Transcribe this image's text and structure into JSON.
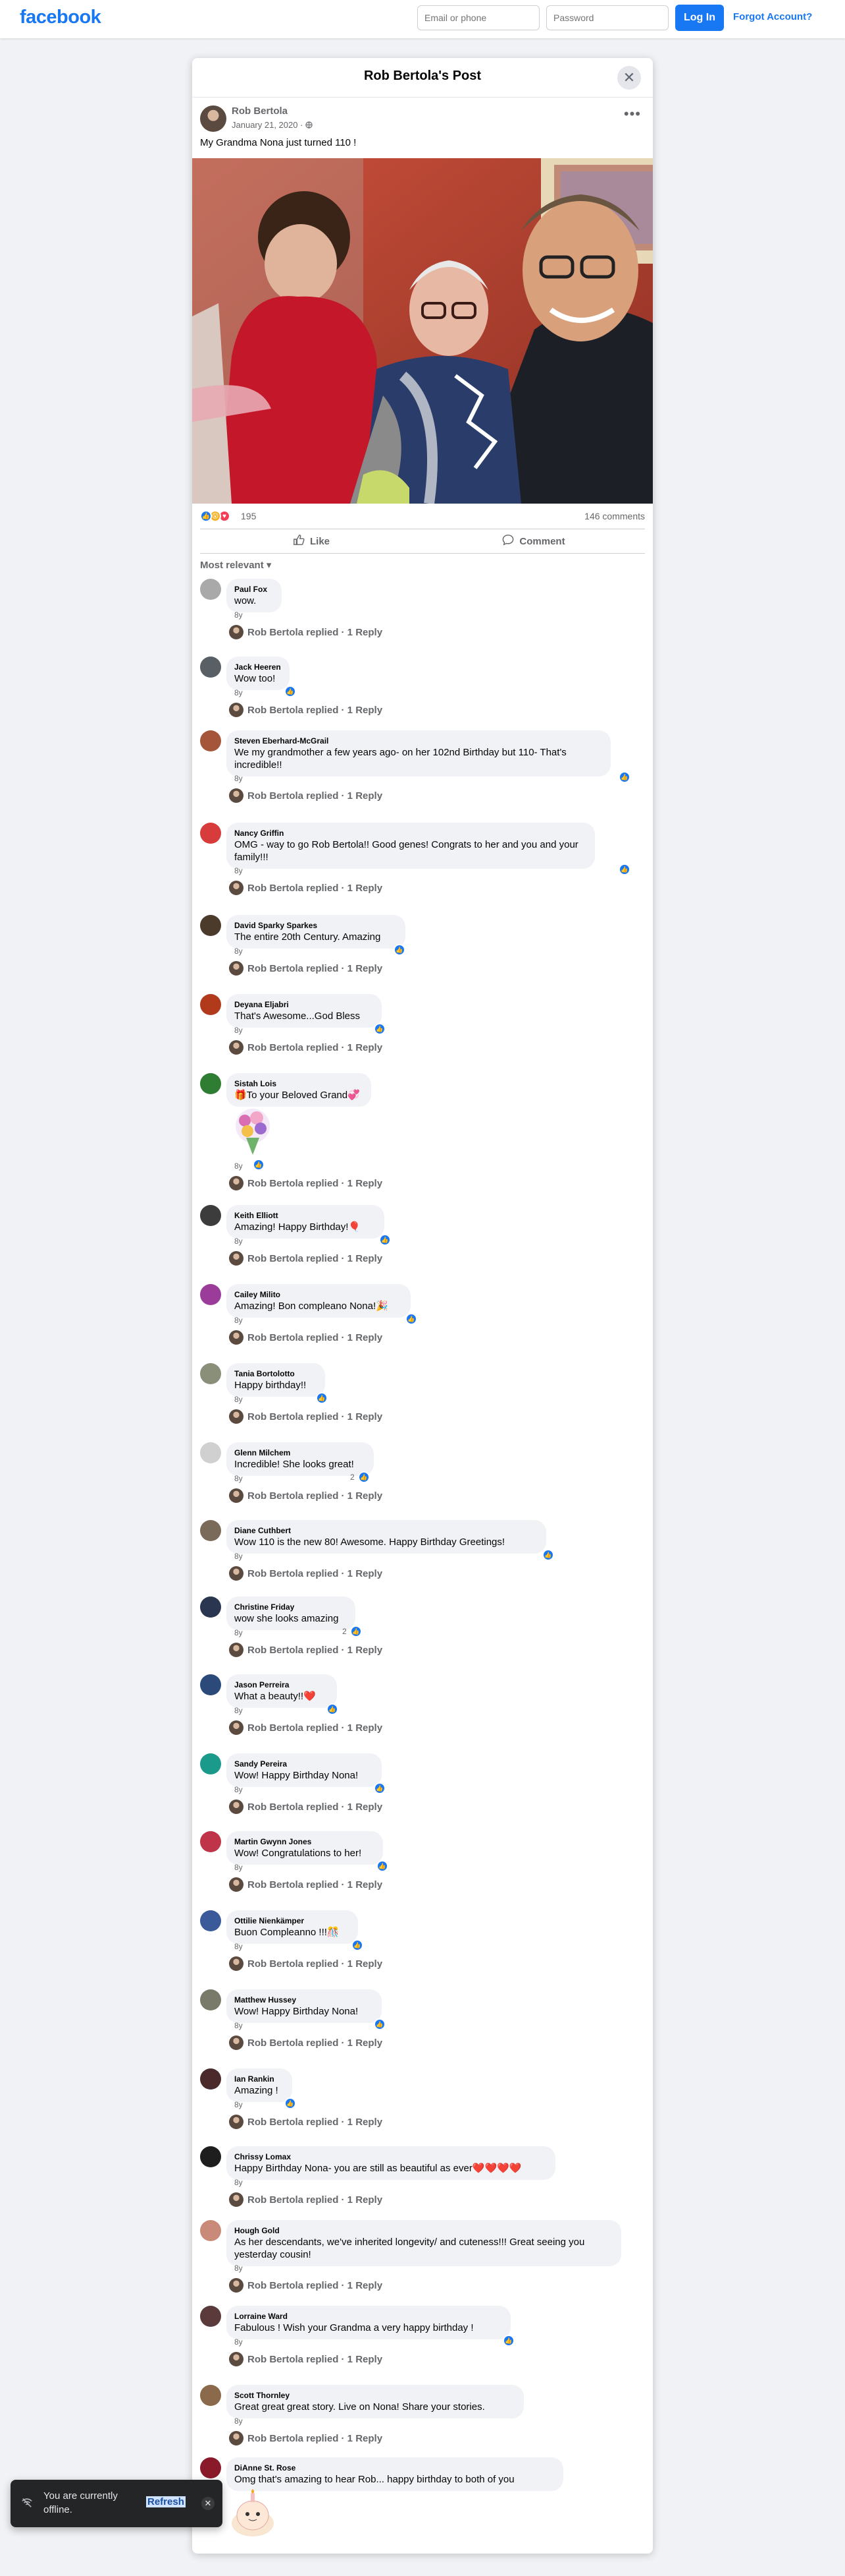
{
  "header": {
    "logo": "facebook",
    "email_placeholder": "Email or phone",
    "password_placeholder": "Password",
    "login_label": "Log In",
    "forgot_label": "Forgot Account?"
  },
  "dialog": {
    "title": "Rob Bertola's Post",
    "close_icon": "close-icon"
  },
  "post": {
    "author": "Rob Bertola",
    "date": "January 21, 2020 ·",
    "privacy_icon": "globe-icon",
    "text": "My Grandma Nona just turned 110 !",
    "reaction_count": "195",
    "comment_count": "146 comments",
    "like_label": "Like",
    "comment_label": "Comment",
    "sort_label": "Most relevant"
  },
  "comments": [
    {
      "name": "Paul Fox",
      "text": "wow.",
      "time": "8y",
      "like_count": "",
      "reply": "Rob Bertola replied · 1 Reply",
      "avatar_color": "#a9a9a9"
    },
    {
      "name": "Jack Heeren",
      "text": "Wow too!",
      "time": "8y",
      "like_count": "",
      "reply": "Rob Bertola replied · 1 Reply",
      "avatar_color": "#5a5f66"
    },
    {
      "name": "Steven Eberhard-McGrail",
      "text": "We my grandmother a few years ago- on her 102nd Birthday but 110- That's incredible!!",
      "time": "8y",
      "like_count": "",
      "reply": "Rob Bertola replied · 1 Reply",
      "avatar_color": "#a4553a"
    },
    {
      "name": "Nancy Griffin",
      "text": "OMG - way to go Rob Bertola!! Good genes! Congrats to her and you and your family!!!",
      "time": "8y",
      "like_count": "",
      "reply": "Rob Bertola replied · 1 Reply",
      "avatar_color": "#d73b3b"
    },
    {
      "name": "David Sparky Sparkes",
      "text": "The entire 20th Century. Amazing",
      "time": "8y",
      "like_count": "",
      "reply": "Rob Bertola replied · 1 Reply",
      "avatar_color": "#4a3b2a"
    },
    {
      "name": "Deyana Eljabri",
      "text": "That's Awesome...God Bless",
      "time": "8y",
      "like_count": "",
      "reply": "Rob Bertola replied · 1 Reply",
      "avatar_color": "#b23a1c"
    },
    {
      "name": "Sistah Lois",
      "text": "🎁To your Beloved Grand💞",
      "time": "8y",
      "like_count": "",
      "reply": "Rob Bertola replied · 1 Reply",
      "avatar_color": "#2e7d32"
    },
    {
      "name": "Keith Elliott",
      "text": "Amazing! Happy Birthday!🎈",
      "time": "8y",
      "like_count": "",
      "reply": "Rob Bertola replied · 1 Reply",
      "avatar_color": "#3c3c3c"
    },
    {
      "name": "Cailey Milito",
      "text": "Amazing! Bon compleano Nona!🎉",
      "time": "8y",
      "like_count": "",
      "reply": "Rob Bertola replied · 1 Reply",
      "avatar_color": "#9b3c9b"
    },
    {
      "name": "Tania Bortolotto",
      "text": "Happy birthday!!",
      "time": "8y",
      "like_count": "",
      "reply": "Rob Bertola replied · 1 Reply",
      "avatar_color": "#8a8f7a"
    },
    {
      "name": "Glenn Milchem",
      "text": "Incredible! She looks great!",
      "time": "8y",
      "like_count": "2",
      "reply": "Rob Bertola replied · 1 Reply",
      "avatar_color": "#d0d0d0"
    },
    {
      "name": "Diane Cuthbert",
      "text": "Wow 110 is the new 80! Awesome. Happy Birthday Greetings!",
      "time": "8y",
      "like_count": "",
      "reply": "Rob Bertola replied · 1 Reply",
      "avatar_color": "#7a6a5a"
    },
    {
      "name": "Christine Friday",
      "text": "wow she looks amazing",
      "time": "8y",
      "like_count": "2",
      "reply": "Rob Bertola replied · 1 Reply",
      "avatar_color": "#2a3550"
    },
    {
      "name": "Jason Perreira",
      "text": "What a beauty!!❤️",
      "time": "8y",
      "like_count": "",
      "reply": "Rob Bertola replied · 1 Reply",
      "avatar_color": "#2b4a7a"
    },
    {
      "name": "Sandy Pereira",
      "text": "Wow! Happy Birthday Nona!",
      "time": "8y",
      "like_count": "",
      "reply": "Rob Bertola replied · 1 Reply",
      "avatar_color": "#1a9a8a"
    },
    {
      "name": "Martin Gwynn Jones",
      "text": "Wow! Congratulations to her!",
      "time": "8y",
      "like_count": "",
      "reply": "Rob Bertola replied · 1 Reply",
      "avatar_color": "#c0344a"
    },
    {
      "name": "Ottilie Nienkämper",
      "text": "Buon Compleanno !!!🎊",
      "time": "8y",
      "like_count": "",
      "reply": "Rob Bertola replied · 1 Reply",
      "avatar_color": "#3a5a9a"
    },
    {
      "name": "Matthew Hussey",
      "text": "Wow! Happy Birthday Nona!",
      "time": "8y",
      "like_count": "",
      "reply": "Rob Bertola replied · 1 Reply",
      "avatar_color": "#7a7a6a"
    },
    {
      "name": "Ian Rankin",
      "text": "Amazing !",
      "time": "8y",
      "like_count": "",
      "reply": "Rob Bertola replied · 1 Reply",
      "avatar_color": "#4a2a2a"
    },
    {
      "name": "Chrissy Lomax",
      "text": "Happy Birthday Nona- you are still as beautiful as ever❤️❤️❤️❤️",
      "time": "8y",
      "like_count": "",
      "reply": "Rob Bertola replied · 1 Reply",
      "avatar_color": "#1e1e1e"
    },
    {
      "name": "Hough Gold",
      "text": "As her descendants, we've inherited longevity/ and cuteness!!! Great seeing you yesterday cousin!",
      "time": "8y",
      "like_count": "",
      "reply": "Rob Bertola replied · 1 Reply",
      "avatar_color": "#c98a7a"
    },
    {
      "name": "Lorraine Ward",
      "text": "Fabulous ! Wish your Grandma a very happy birthday !",
      "time": "8y",
      "like_count": "",
      "reply": "Rob Bertola replied · 1 Reply",
      "avatar_color": "#5a3a3a"
    },
    {
      "name": "Scott Thornley",
      "text": "Great great great story. Live on Nona! Share your stories.",
      "time": "8y",
      "like_count": "",
      "reply": "Rob Bertola replied · 1 Reply",
      "avatar_color": "#8a6a4a"
    },
    {
      "name": "DiAnne St. Rose",
      "text": "Omg that's amazing to hear Rob... happy birthday to both of you",
      "time": "",
      "like_count": "",
      "reply": "",
      "avatar_color": "#8a1a2a"
    }
  ],
  "toast": {
    "text": "You are currently offline.",
    "action_label": "Refresh",
    "icon": "wifi-off-icon"
  }
}
